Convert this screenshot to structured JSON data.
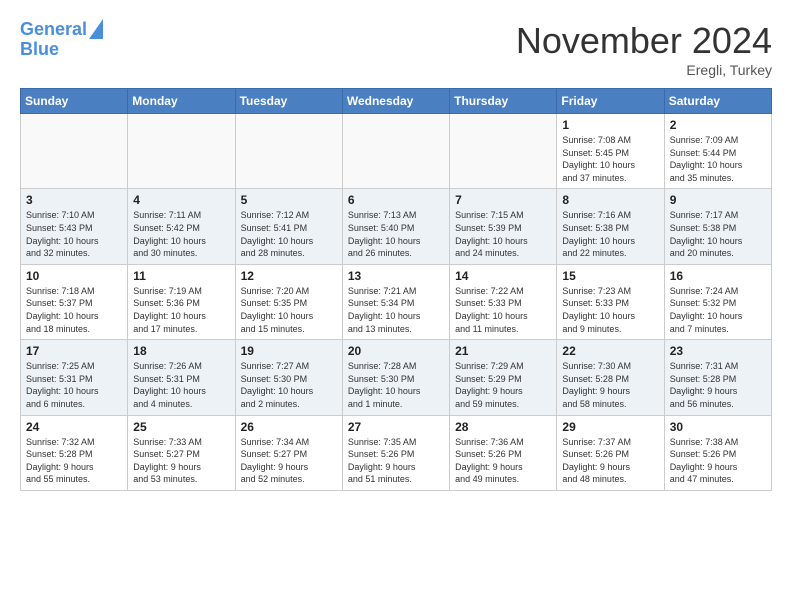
{
  "header": {
    "logo_line1": "General",
    "logo_line2": "Blue",
    "month": "November 2024",
    "location": "Eregli, Turkey"
  },
  "weekdays": [
    "Sunday",
    "Monday",
    "Tuesday",
    "Wednesday",
    "Thursday",
    "Friday",
    "Saturday"
  ],
  "weeks": [
    [
      {
        "day": "",
        "info": ""
      },
      {
        "day": "",
        "info": ""
      },
      {
        "day": "",
        "info": ""
      },
      {
        "day": "",
        "info": ""
      },
      {
        "day": "",
        "info": ""
      },
      {
        "day": "1",
        "info": "Sunrise: 7:08 AM\nSunset: 5:45 PM\nDaylight: 10 hours\nand 37 minutes."
      },
      {
        "day": "2",
        "info": "Sunrise: 7:09 AM\nSunset: 5:44 PM\nDaylight: 10 hours\nand 35 minutes."
      }
    ],
    [
      {
        "day": "3",
        "info": "Sunrise: 7:10 AM\nSunset: 5:43 PM\nDaylight: 10 hours\nand 32 minutes."
      },
      {
        "day": "4",
        "info": "Sunrise: 7:11 AM\nSunset: 5:42 PM\nDaylight: 10 hours\nand 30 minutes."
      },
      {
        "day": "5",
        "info": "Sunrise: 7:12 AM\nSunset: 5:41 PM\nDaylight: 10 hours\nand 28 minutes."
      },
      {
        "day": "6",
        "info": "Sunrise: 7:13 AM\nSunset: 5:40 PM\nDaylight: 10 hours\nand 26 minutes."
      },
      {
        "day": "7",
        "info": "Sunrise: 7:15 AM\nSunset: 5:39 PM\nDaylight: 10 hours\nand 24 minutes."
      },
      {
        "day": "8",
        "info": "Sunrise: 7:16 AM\nSunset: 5:38 PM\nDaylight: 10 hours\nand 22 minutes."
      },
      {
        "day": "9",
        "info": "Sunrise: 7:17 AM\nSunset: 5:38 PM\nDaylight: 10 hours\nand 20 minutes."
      }
    ],
    [
      {
        "day": "10",
        "info": "Sunrise: 7:18 AM\nSunset: 5:37 PM\nDaylight: 10 hours\nand 18 minutes."
      },
      {
        "day": "11",
        "info": "Sunrise: 7:19 AM\nSunset: 5:36 PM\nDaylight: 10 hours\nand 17 minutes."
      },
      {
        "day": "12",
        "info": "Sunrise: 7:20 AM\nSunset: 5:35 PM\nDaylight: 10 hours\nand 15 minutes."
      },
      {
        "day": "13",
        "info": "Sunrise: 7:21 AM\nSunset: 5:34 PM\nDaylight: 10 hours\nand 13 minutes."
      },
      {
        "day": "14",
        "info": "Sunrise: 7:22 AM\nSunset: 5:33 PM\nDaylight: 10 hours\nand 11 minutes."
      },
      {
        "day": "15",
        "info": "Sunrise: 7:23 AM\nSunset: 5:33 PM\nDaylight: 10 hours\nand 9 minutes."
      },
      {
        "day": "16",
        "info": "Sunrise: 7:24 AM\nSunset: 5:32 PM\nDaylight: 10 hours\nand 7 minutes."
      }
    ],
    [
      {
        "day": "17",
        "info": "Sunrise: 7:25 AM\nSunset: 5:31 PM\nDaylight: 10 hours\nand 6 minutes."
      },
      {
        "day": "18",
        "info": "Sunrise: 7:26 AM\nSunset: 5:31 PM\nDaylight: 10 hours\nand 4 minutes."
      },
      {
        "day": "19",
        "info": "Sunrise: 7:27 AM\nSunset: 5:30 PM\nDaylight: 10 hours\nand 2 minutes."
      },
      {
        "day": "20",
        "info": "Sunrise: 7:28 AM\nSunset: 5:30 PM\nDaylight: 10 hours\nand 1 minute."
      },
      {
        "day": "21",
        "info": "Sunrise: 7:29 AM\nSunset: 5:29 PM\nDaylight: 9 hours\nand 59 minutes."
      },
      {
        "day": "22",
        "info": "Sunrise: 7:30 AM\nSunset: 5:28 PM\nDaylight: 9 hours\nand 58 minutes."
      },
      {
        "day": "23",
        "info": "Sunrise: 7:31 AM\nSunset: 5:28 PM\nDaylight: 9 hours\nand 56 minutes."
      }
    ],
    [
      {
        "day": "24",
        "info": "Sunrise: 7:32 AM\nSunset: 5:28 PM\nDaylight: 9 hours\nand 55 minutes."
      },
      {
        "day": "25",
        "info": "Sunrise: 7:33 AM\nSunset: 5:27 PM\nDaylight: 9 hours\nand 53 minutes."
      },
      {
        "day": "26",
        "info": "Sunrise: 7:34 AM\nSunset: 5:27 PM\nDaylight: 9 hours\nand 52 minutes."
      },
      {
        "day": "27",
        "info": "Sunrise: 7:35 AM\nSunset: 5:26 PM\nDaylight: 9 hours\nand 51 minutes."
      },
      {
        "day": "28",
        "info": "Sunrise: 7:36 AM\nSunset: 5:26 PM\nDaylight: 9 hours\nand 49 minutes."
      },
      {
        "day": "29",
        "info": "Sunrise: 7:37 AM\nSunset: 5:26 PM\nDaylight: 9 hours\nand 48 minutes."
      },
      {
        "day": "30",
        "info": "Sunrise: 7:38 AM\nSunset: 5:26 PM\nDaylight: 9 hours\nand 47 minutes."
      }
    ]
  ]
}
